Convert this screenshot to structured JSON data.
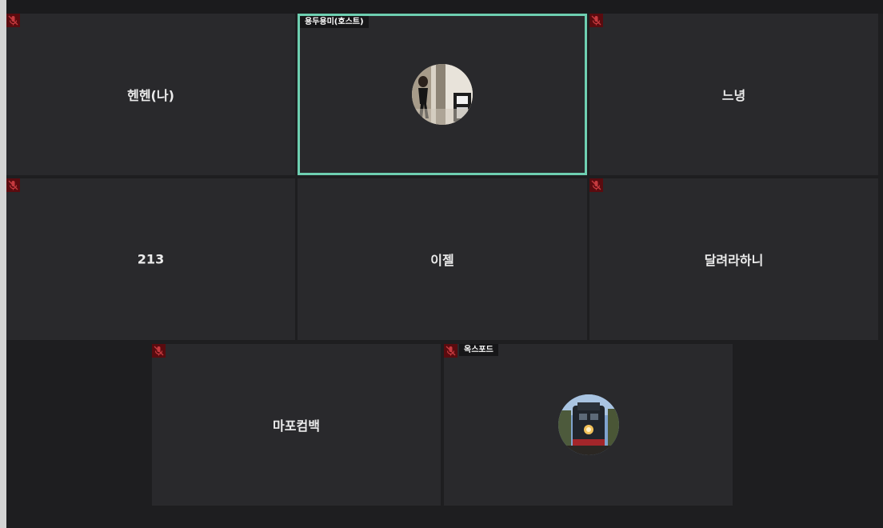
{
  "app": {
    "colors": {
      "background": "#1e1e20",
      "tile": "#29292c",
      "active_speaker": "#6ecfb1",
      "mute_badge": "#5a0b0f"
    }
  },
  "participants": [
    {
      "name": "헨헨(나)",
      "muted": true,
      "video": false
    },
    {
      "name": "",
      "tag": "용두용미(호스트)",
      "muted": false,
      "video": true,
      "active_speaker": true,
      "avatar": "photo-avatar"
    },
    {
      "name": "느녕",
      "muted": true,
      "video": false
    },
    {
      "name": "213",
      "muted": true,
      "video": false
    },
    {
      "name": "이젤",
      "muted": false,
      "video": false
    },
    {
      "name": "달려라하니",
      "muted": true,
      "video": false
    },
    {
      "name": "마포컴백",
      "muted": true,
      "video": false
    },
    {
      "name": "",
      "tag": "옥스포드",
      "muted": true,
      "video": true,
      "avatar": "train-photo-avatar"
    }
  ]
}
